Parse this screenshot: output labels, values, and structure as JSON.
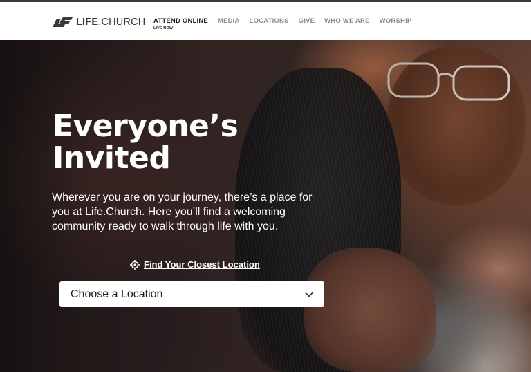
{
  "header": {
    "logo_text_bold": "LIFE",
    "logo_text_rest": ".CHURCH",
    "nav": [
      {
        "label": "ATTEND ONLINE",
        "sublabel": "LIVE NOW",
        "active": true
      },
      {
        "label": "MEDIA"
      },
      {
        "label": "LOCATIONS"
      },
      {
        "label": "GIVE"
      },
      {
        "label": "WHO WE ARE"
      },
      {
        "label": "WORSHIP"
      }
    ]
  },
  "hero": {
    "title_line1": "Everyone’s",
    "title_line2": "Invited",
    "body": "Wherever you are on your journey, there’s a place for you at Life.Church. Here you’ll find a welcoming community ready to walk through life with you.",
    "find_link": "Find Your Closest Location",
    "location_select": "Choose a Location"
  },
  "colors": {
    "header_bg": "#ffffff",
    "nav_active": "#1e1e1e",
    "nav_inactive": "#8a8a8a",
    "hero_text": "#ffffff"
  },
  "icons": {
    "logo": "life-church-logo-mark",
    "find_location": "location-target-icon",
    "select_caret": "chevron-down-icon"
  }
}
